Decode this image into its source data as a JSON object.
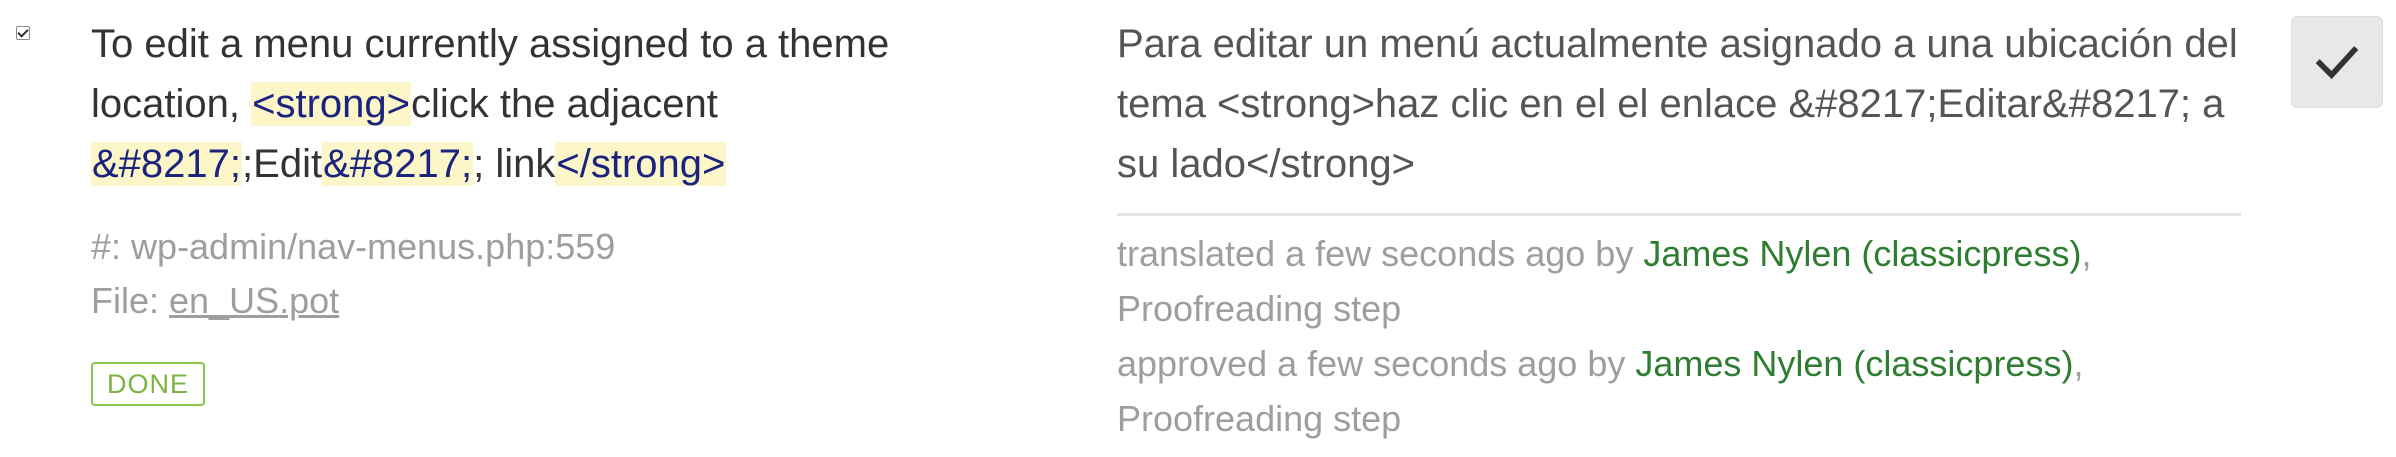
{
  "source": {
    "parts": [
      {
        "text": "To edit a menu currently assigned to a theme location, ",
        "tag": false
      },
      {
        "text": "<strong>",
        "tag": true
      },
      {
        "text": "click the adjacent ",
        "tag": false
      },
      {
        "text": "&#8217;",
        "tag": true
      },
      {
        "text": ";Edit",
        "tag": false
      },
      {
        "text": "&#8217;",
        "tag": true
      },
      {
        "text": "; link",
        "tag": false
      },
      {
        "text": "</strong>",
        "tag": true
      }
    ]
  },
  "meta": {
    "reference": "#: wp-admin/nav-menus.php:559",
    "file_label": "File: ",
    "file_link": "en_US.pot"
  },
  "status_badge": "DONE",
  "translation": {
    "text": "Para editar un menú actualmente asignado a una ubicación del tema <strong>haz clic en el el enlace &#8217;Editar&#8217; a su lado</strong>"
  },
  "history": [
    {
      "action": "translated a few seconds ago by ",
      "user": "James Nylen (classicpress)",
      "sep": ",",
      "step": "Proofreading step"
    },
    {
      "action": "approved a few seconds ago by ",
      "user": "James Nylen (classicpress)",
      "sep": ",",
      "step": "Proofreading step"
    }
  ],
  "approve_button": {
    "icon": "checkmark-icon",
    "color": "#333333"
  }
}
